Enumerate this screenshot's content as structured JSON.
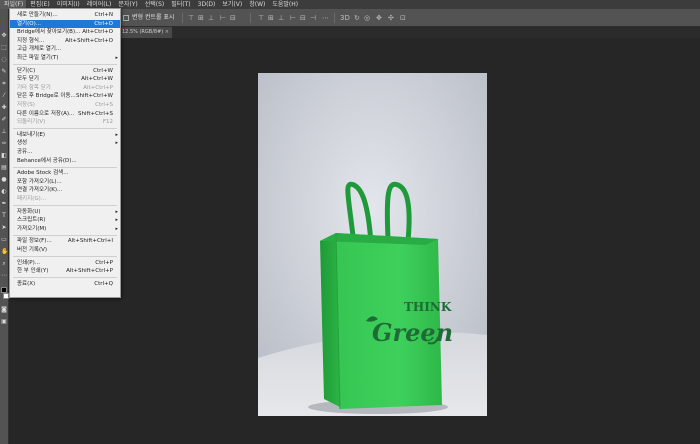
{
  "menubar": {
    "items": [
      "파일(F)",
      "편집(E)",
      "이미지(I)",
      "레이어(L)",
      "문자(Y)",
      "선택(S)",
      "필터(T)",
      "3D(D)",
      "보기(V)",
      "창(W)",
      "도움말(H)"
    ]
  },
  "options": {
    "transform_controls_label": "변형 컨트롤 표시"
  },
  "document_tab": {
    "title": "12.5% (RGB/8#)",
    "close": "×"
  },
  "file_menu": {
    "items": [
      {
        "label": "새로 만들기(N)...",
        "shortcut": "Ctrl+N"
      },
      {
        "label": "열기(O)...",
        "shortcut": "Ctrl+O",
        "highlighted": true
      },
      {
        "label": "Bridge에서 찾아보기(B)...",
        "shortcut": "Alt+Ctrl+O"
      },
      {
        "label": "지정 형식...",
        "shortcut": "Alt+Shift+Ctrl+O"
      },
      {
        "label": "고급 개체로 열기...",
        "shortcut": ""
      },
      {
        "label": "최근 파일 열기(T)",
        "shortcut": "",
        "submenu": true
      },
      {
        "label": "닫기(C)",
        "shortcut": "Ctrl+W"
      },
      {
        "label": "모두 닫기",
        "shortcut": "Alt+Ctrl+W"
      },
      {
        "label": "기타 항목 닫기",
        "shortcut": "Alt+Ctrl+P",
        "disabled": true
      },
      {
        "label": "닫은 후 Bridge로 이동...",
        "shortcut": "Shift+Ctrl+W"
      },
      {
        "label": "저장(S)",
        "shortcut": "Ctrl+S",
        "disabled": true
      },
      {
        "label": "다른 이름으로 저장(A)...",
        "shortcut": "Shift+Ctrl+S"
      },
      {
        "label": "되돌리기(V)",
        "shortcut": "F12",
        "disabled": true
      },
      {
        "label": "내보내기(E)",
        "shortcut": "",
        "submenu": true
      },
      {
        "label": "생성",
        "shortcut": "",
        "submenu": true
      },
      {
        "label": "공유...",
        "shortcut": ""
      },
      {
        "label": "Behance에서 공유(D)...",
        "shortcut": ""
      },
      {
        "label": "Adobe Stock 검색...",
        "shortcut": ""
      },
      {
        "label": "포함 가져오기(L)...",
        "shortcut": ""
      },
      {
        "label": "연결 가져오기(K)...",
        "shortcut": ""
      },
      {
        "label": "패키지(G)...",
        "shortcut": "",
        "disabled": true
      },
      {
        "label": "자동화(U)",
        "shortcut": "",
        "submenu": true
      },
      {
        "label": "스크립트(R)",
        "shortcut": "",
        "submenu": true
      },
      {
        "label": "가져오기(M)",
        "shortcut": "",
        "submenu": true
      },
      {
        "label": "파일 정보(F)...",
        "shortcut": "Alt+Shift+Ctrl+I"
      },
      {
        "label": "버전 기록(V)",
        "shortcut": ""
      },
      {
        "label": "인쇄(P)...",
        "shortcut": "Ctrl+P"
      },
      {
        "label": "한 부 인쇄(Y)",
        "shortcut": "Alt+Shift+Ctrl+P"
      },
      {
        "label": "종료(X)",
        "shortcut": "Ctrl+Q"
      }
    ]
  },
  "image": {
    "bag_text_line1": "THINK",
    "bag_text_line2": "Green"
  },
  "colors": {
    "menu_highlight": "#1e78d8",
    "bag_green": "#2fbf4a",
    "bag_print": "#1f6b35"
  }
}
